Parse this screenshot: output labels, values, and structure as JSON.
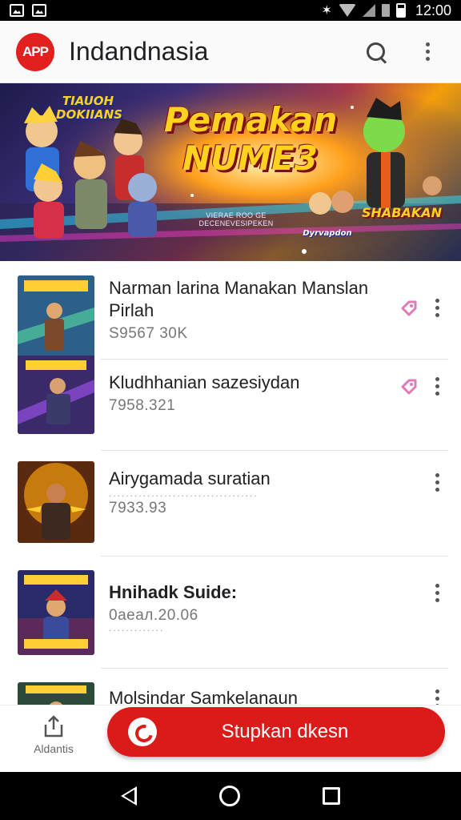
{
  "status_bar": {
    "time": "12:00"
  },
  "app_bar": {
    "logo_text": "APP",
    "title": "Indandnasia",
    "search_icon": "search-icon",
    "menu_icon": "more-vert-icon"
  },
  "banner": {
    "title_line1": "Pemakan",
    "title_line2": "NUME3",
    "logo_left": "TIAUOH DOKIIANS",
    "subtitle": "VIERAE ROO GE DECENEVESIPEKEN",
    "logo_mid": "Dyrvapdon",
    "logo_right": "SHABAKAN"
  },
  "list": {
    "items": [
      {
        "title": "Narman larina Manakan Manslan Pirlah",
        "meta": "S9567 30K",
        "has_tag": true
      },
      {
        "title": "Kludhhanian sazesiydan",
        "meta": "7958.321",
        "has_tag": true
      },
      {
        "title": "Airygamada suratian",
        "meta": "7933.93",
        "has_tag": false
      },
      {
        "title": "Hnihadk Suide:",
        "meta": "0aeaл.20.06",
        "has_tag": false
      },
      {
        "title": "Molsindar Samkelanaun",
        "meta": "",
        "has_tag": false
      }
    ]
  },
  "bottom_bar": {
    "share_label": "Aldantis",
    "cta_label": "Stupkan dkesn",
    "share_icon": "share-icon",
    "cta_icon": "whatsapp-icon"
  },
  "colors": {
    "brand_red": "#db1a1a",
    "tag_pink": "#e07ab8"
  }
}
